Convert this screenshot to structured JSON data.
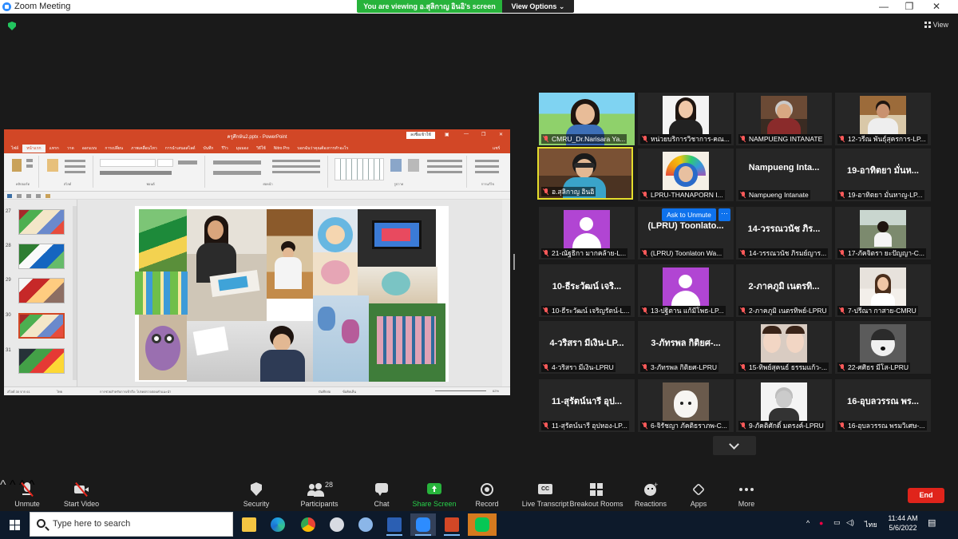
{
  "window": {
    "title": "Zoom Meeting",
    "minimize": "—",
    "restore": "❐",
    "close": "✕"
  },
  "share": {
    "banner": "You are viewing อ.สุลิกาญ อินอิ's screen",
    "view_options": "View Options ⌄"
  },
  "view_label": "View",
  "ppt": {
    "title": "ครูศึกษัน2.pptx - PowerPoint",
    "signin": "ลงชื่อเข้าใช้",
    "tabs": [
      "ไฟล์",
      "หน้าแรก",
      "แทรก",
      "วาด",
      "ออกแบบ",
      "การเปลี่ยน",
      "ภาพเคลื่อนไหว",
      "การนำเสนอสไลด์",
      "บันทึก",
      "รีวิว",
      "มุมมอง",
      "วิธีใช้",
      "Nitro Pro",
      "บอกฉันว่าคุณต้องการทำอะไร"
    ],
    "share_tab": "แชร์",
    "ribbon_groups": [
      "คลิปบอร์ด",
      "สไลด์",
      "ฟอนต์",
      "ย่อหน้า",
      "รูปวาด",
      "การแก้ไข"
    ],
    "thumb_numbers": [
      "27",
      "28",
      "29",
      "30",
      "31"
    ],
    "status_left": "สไลด์ 30 จาก 61",
    "status_lang": "ไทย",
    "status_access": "การช่วยสำหรับการเข้าถึง: โปรดตรวจสอบคำแนะนำ",
    "status_notes": "บันทึกย่อ",
    "status_comments": "ข้อคิดเห็น",
    "zoom": "62%"
  },
  "participants": [
    {
      "label": "CMRU_Dr.Narisara Ya...",
      "type": "video-banner"
    },
    {
      "label": "หน่วยบริการวิชาการ-คณ...",
      "type": "video-woman"
    },
    {
      "label": "NAMPUENG INTANATE",
      "type": "video-office"
    },
    {
      "label": "12-วรีณ พันธุ์สุครการ-LP...",
      "type": "video-man"
    },
    {
      "label": "อ.สุลิกาญ อินอิ",
      "type": "video-active"
    },
    {
      "label": "LPRU-THANAPORN I...",
      "type": "video-rainbow"
    },
    {
      "label": "Nampueng Intanate",
      "type": "name",
      "big": "Nampueng Inta..."
    },
    {
      "label": "19-อาทิตยา มั่นหาญ-LP...",
      "type": "name",
      "big": "19-อาทิตยา มั่นห..."
    },
    {
      "label": "21-ณัฐธิกา มากคล้าย-L...",
      "type": "avatar"
    },
    {
      "label": "(LPRU) Toonlaton Wa...",
      "type": "name",
      "big": "(LPRU) Toonlato..."
    },
    {
      "label": "14-วรรณวนัช ภิรมย์ญาร...",
      "type": "name",
      "big": "14-วรรณวนัช ภิร..."
    },
    {
      "label": "17-ภัคจิตรา ยะปัญญา-C...",
      "type": "video-outdoor"
    },
    {
      "label": "10-ธีระวัฒน์ เจริญรัตน์-L...",
      "type": "name",
      "big": "10-ธีระวัฒน์ เจริ..."
    },
    {
      "label": "13-ปฐิตาน  แก้มีโพธ-LP...",
      "type": "avatar"
    },
    {
      "label": "2-ภาคภูมิ เนตรทิพย์-LPRU",
      "type": "name",
      "big": "2-ภาคภูมิ เนตรทิ..."
    },
    {
      "label": "7-ปรีณา กาสาย-CMRU",
      "type": "video-girl"
    },
    {
      "label": "4-วริสรา มีเงิน-LPRU",
      "type": "name",
      "big": "4-วริสรา มีเงิน-LP..."
    },
    {
      "label": "3-ภัทรพล กิติยศ-LPRU",
      "type": "name",
      "big": "3-ภัทรพล กิติยศ-..."
    },
    {
      "label": "15-ทิพย์สุคนธ์ ธรรมแก้ว-...",
      "type": "video-filter"
    },
    {
      "label": "22-ศศิธร มีโส-LPRU",
      "type": "video-husky"
    },
    {
      "label": "11-สุรัตน์นารี อุปหอง-LP...",
      "type": "name",
      "big": "11-สุรัตน์นารี อุป..."
    },
    {
      "label": "6-จิรัชญา ภัคติธราภพ-C...",
      "type": "video-dog"
    },
    {
      "label": "9-ภัคติศักดิ์ มตรงค์-LPRU",
      "type": "video-portrait"
    },
    {
      "label": "16-อุบลวรรณ พรมวิเศษ-...",
      "type": "name",
      "big": "16-อุบลวรรณ พร..."
    }
  ],
  "ask_to_unmute": "Ask to Unmute",
  "more_dots": "···",
  "toolbar": {
    "unmute": "Unmute",
    "start_video": "Start Video",
    "security": "Security",
    "participants": "Participants",
    "participants_count": "28",
    "chat": "Chat",
    "share_screen": "Share Screen",
    "record": "Record",
    "live_transcript": "Live Transcript",
    "breakout_rooms": "Breakout Rooms",
    "reactions": "Reactions",
    "apps": "Apps",
    "more": "More",
    "end": "End",
    "cc": "CC"
  },
  "taskbar": {
    "search_placeholder": "Type here to search",
    "lang": "ไทย",
    "time": "11:44 AM",
    "date": "5/6/2022"
  },
  "colors": {
    "zoom_blue": "#0e72ed",
    "share_green": "#27b33b",
    "end_red": "#e0241b",
    "ppt_orange": "#d24726",
    "active_speaker": "#e5de2c"
  }
}
